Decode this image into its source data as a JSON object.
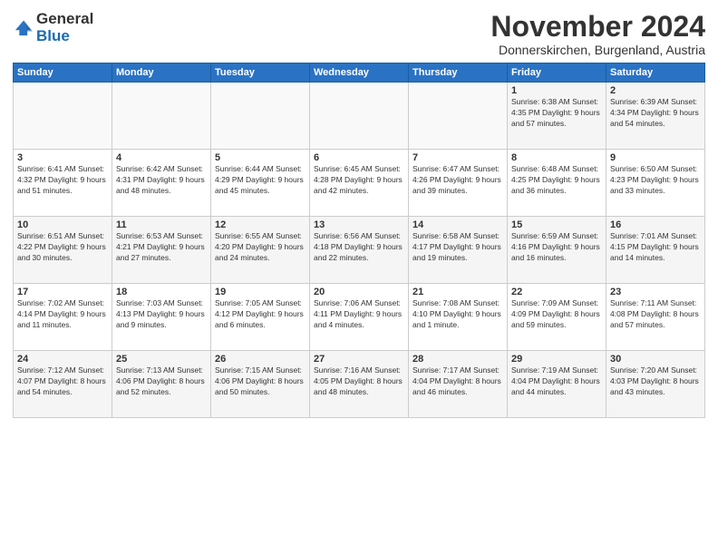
{
  "logo": {
    "general": "General",
    "blue": "Blue"
  },
  "header": {
    "month": "November 2024",
    "location": "Donnerskirchen, Burgenland, Austria"
  },
  "days_of_week": [
    "Sunday",
    "Monday",
    "Tuesday",
    "Wednesday",
    "Thursday",
    "Friday",
    "Saturday"
  ],
  "weeks": [
    [
      {
        "day": "",
        "info": ""
      },
      {
        "day": "",
        "info": ""
      },
      {
        "day": "",
        "info": ""
      },
      {
        "day": "",
        "info": ""
      },
      {
        "day": "",
        "info": ""
      },
      {
        "day": "1",
        "info": "Sunrise: 6:38 AM\nSunset: 4:35 PM\nDaylight: 9 hours and 57 minutes."
      },
      {
        "day": "2",
        "info": "Sunrise: 6:39 AM\nSunset: 4:34 PM\nDaylight: 9 hours and 54 minutes."
      }
    ],
    [
      {
        "day": "3",
        "info": "Sunrise: 6:41 AM\nSunset: 4:32 PM\nDaylight: 9 hours and 51 minutes."
      },
      {
        "day": "4",
        "info": "Sunrise: 6:42 AM\nSunset: 4:31 PM\nDaylight: 9 hours and 48 minutes."
      },
      {
        "day": "5",
        "info": "Sunrise: 6:44 AM\nSunset: 4:29 PM\nDaylight: 9 hours and 45 minutes."
      },
      {
        "day": "6",
        "info": "Sunrise: 6:45 AM\nSunset: 4:28 PM\nDaylight: 9 hours and 42 minutes."
      },
      {
        "day": "7",
        "info": "Sunrise: 6:47 AM\nSunset: 4:26 PM\nDaylight: 9 hours and 39 minutes."
      },
      {
        "day": "8",
        "info": "Sunrise: 6:48 AM\nSunset: 4:25 PM\nDaylight: 9 hours and 36 minutes."
      },
      {
        "day": "9",
        "info": "Sunrise: 6:50 AM\nSunset: 4:23 PM\nDaylight: 9 hours and 33 minutes."
      }
    ],
    [
      {
        "day": "10",
        "info": "Sunrise: 6:51 AM\nSunset: 4:22 PM\nDaylight: 9 hours and 30 minutes."
      },
      {
        "day": "11",
        "info": "Sunrise: 6:53 AM\nSunset: 4:21 PM\nDaylight: 9 hours and 27 minutes."
      },
      {
        "day": "12",
        "info": "Sunrise: 6:55 AM\nSunset: 4:20 PM\nDaylight: 9 hours and 24 minutes."
      },
      {
        "day": "13",
        "info": "Sunrise: 6:56 AM\nSunset: 4:18 PM\nDaylight: 9 hours and 22 minutes."
      },
      {
        "day": "14",
        "info": "Sunrise: 6:58 AM\nSunset: 4:17 PM\nDaylight: 9 hours and 19 minutes."
      },
      {
        "day": "15",
        "info": "Sunrise: 6:59 AM\nSunset: 4:16 PM\nDaylight: 9 hours and 16 minutes."
      },
      {
        "day": "16",
        "info": "Sunrise: 7:01 AM\nSunset: 4:15 PM\nDaylight: 9 hours and 14 minutes."
      }
    ],
    [
      {
        "day": "17",
        "info": "Sunrise: 7:02 AM\nSunset: 4:14 PM\nDaylight: 9 hours and 11 minutes."
      },
      {
        "day": "18",
        "info": "Sunrise: 7:03 AM\nSunset: 4:13 PM\nDaylight: 9 hours and 9 minutes."
      },
      {
        "day": "19",
        "info": "Sunrise: 7:05 AM\nSunset: 4:12 PM\nDaylight: 9 hours and 6 minutes."
      },
      {
        "day": "20",
        "info": "Sunrise: 7:06 AM\nSunset: 4:11 PM\nDaylight: 9 hours and 4 minutes."
      },
      {
        "day": "21",
        "info": "Sunrise: 7:08 AM\nSunset: 4:10 PM\nDaylight: 9 hours and 1 minute."
      },
      {
        "day": "22",
        "info": "Sunrise: 7:09 AM\nSunset: 4:09 PM\nDaylight: 8 hours and 59 minutes."
      },
      {
        "day": "23",
        "info": "Sunrise: 7:11 AM\nSunset: 4:08 PM\nDaylight: 8 hours and 57 minutes."
      }
    ],
    [
      {
        "day": "24",
        "info": "Sunrise: 7:12 AM\nSunset: 4:07 PM\nDaylight: 8 hours and 54 minutes."
      },
      {
        "day": "25",
        "info": "Sunrise: 7:13 AM\nSunset: 4:06 PM\nDaylight: 8 hours and 52 minutes."
      },
      {
        "day": "26",
        "info": "Sunrise: 7:15 AM\nSunset: 4:06 PM\nDaylight: 8 hours and 50 minutes."
      },
      {
        "day": "27",
        "info": "Sunrise: 7:16 AM\nSunset: 4:05 PM\nDaylight: 8 hours and 48 minutes."
      },
      {
        "day": "28",
        "info": "Sunrise: 7:17 AM\nSunset: 4:04 PM\nDaylight: 8 hours and 46 minutes."
      },
      {
        "day": "29",
        "info": "Sunrise: 7:19 AM\nSunset: 4:04 PM\nDaylight: 8 hours and 44 minutes."
      },
      {
        "day": "30",
        "info": "Sunrise: 7:20 AM\nSunset: 4:03 PM\nDaylight: 8 hours and 43 minutes."
      }
    ]
  ]
}
